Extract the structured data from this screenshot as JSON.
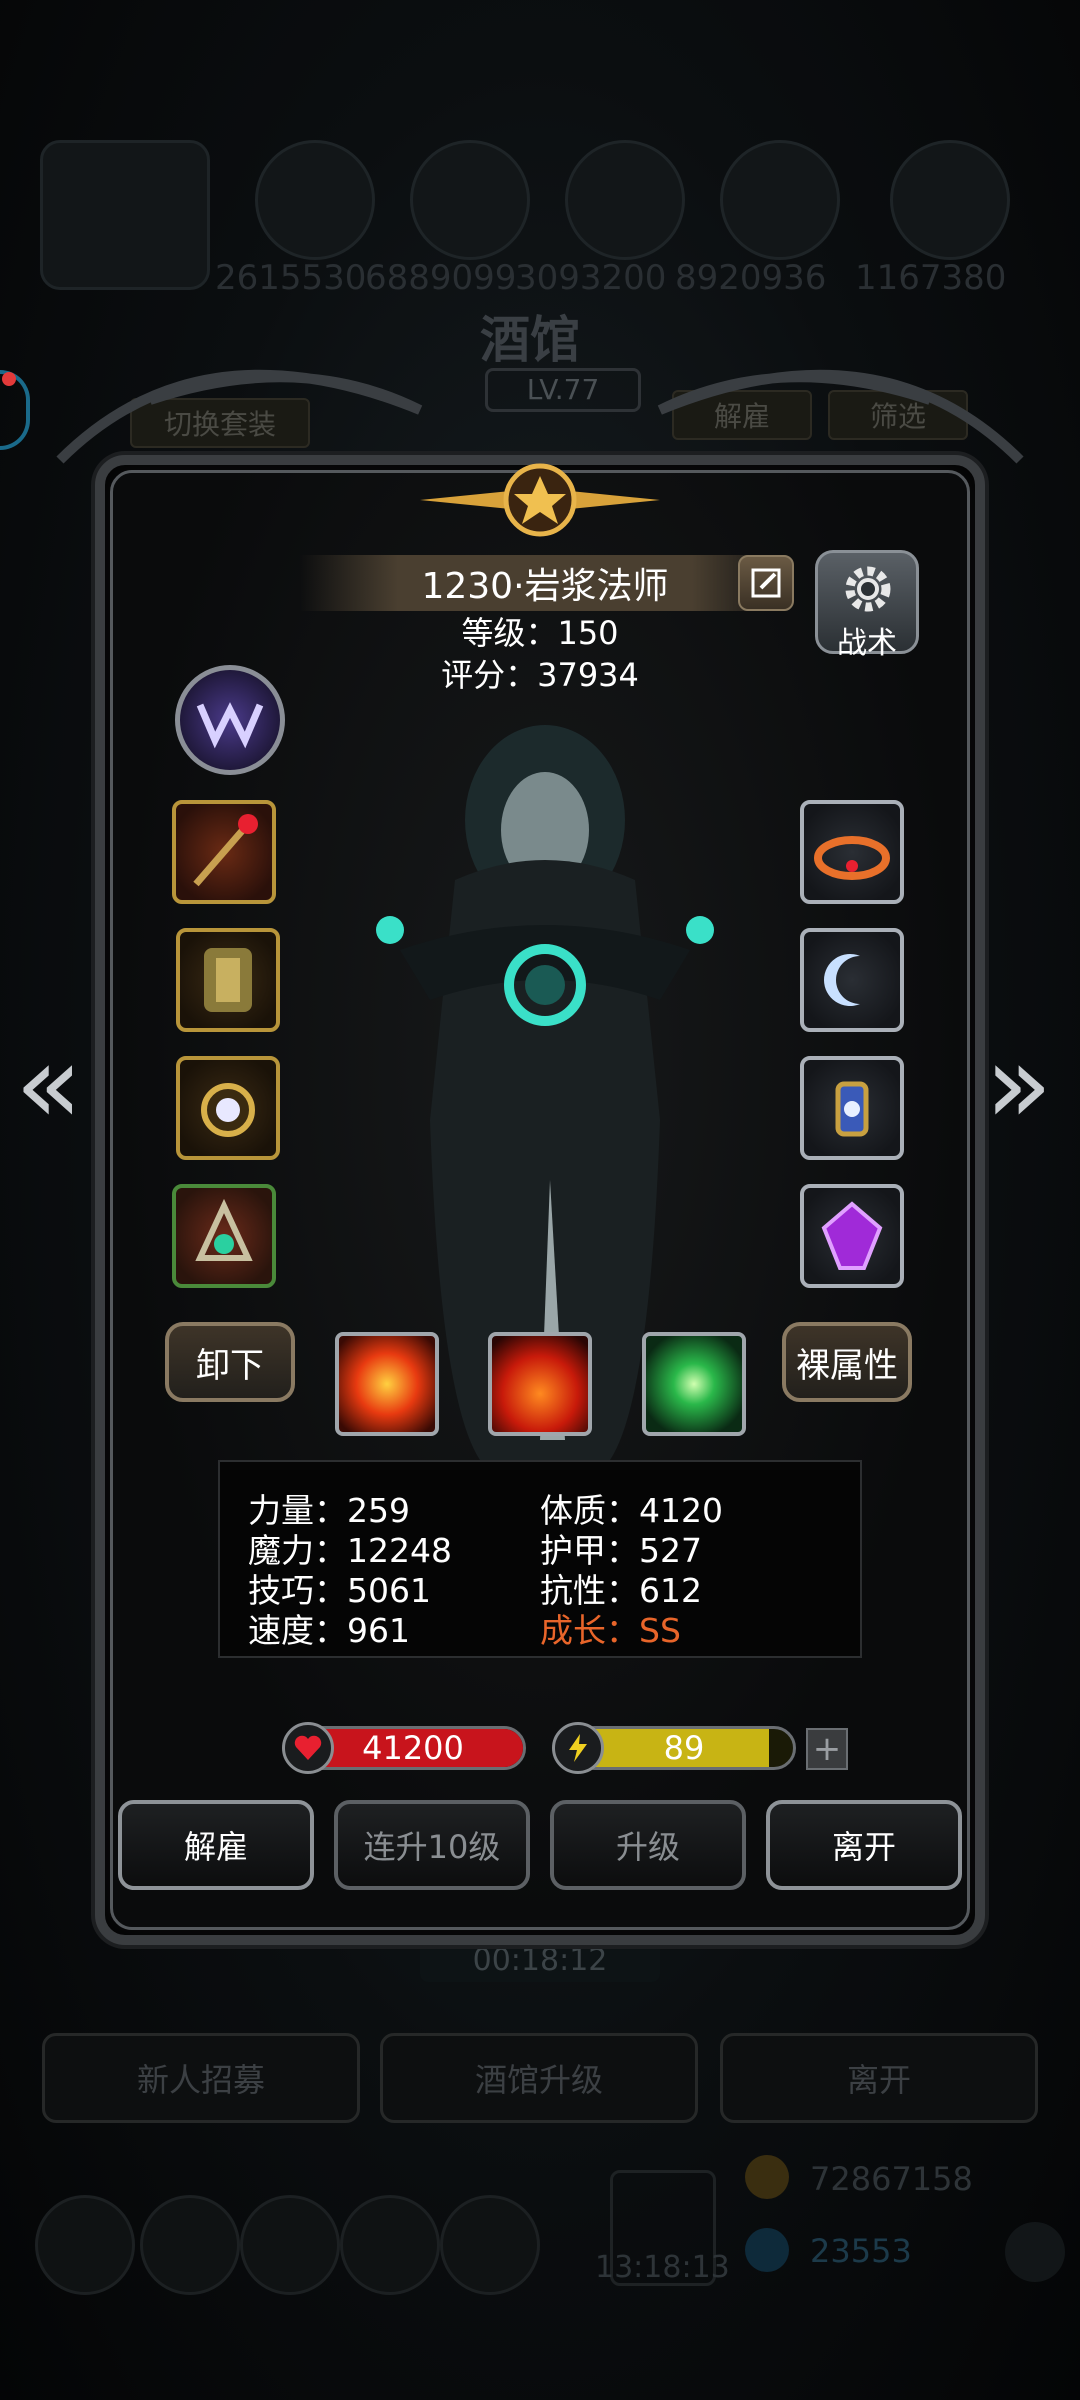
{
  "background": {
    "numbers": [
      "2615530",
      "6889099",
      "3093200",
      "8920936",
      "1167380"
    ],
    "title": "酒馆",
    "level": "LV.77",
    "switch_outfit": "切换套装",
    "dismiss": "解雇",
    "filter": "筛选",
    "timer": "00:18:12",
    "bottom_buttons": [
      "新人招募",
      "酒馆升级",
      "离开"
    ],
    "gold": "72867158",
    "gems": "23553",
    "clock": "13:18:13"
  },
  "hero": {
    "name": "1230·岩浆法师",
    "level_line": "等级：150",
    "score_line": "评分：37934",
    "tactics_label": "战术"
  },
  "equipment": {
    "left": [
      "staff-icon",
      "armor-icon",
      "amulet-icon",
      "relic-icon"
    ],
    "right": [
      "crown-icon",
      "moon-icon",
      "lantern-icon",
      "gem-icon"
    ],
    "rune": "demon-rune-icon"
  },
  "controls": {
    "unequip": "卸下",
    "bare_stats": "裸属性",
    "skills": [
      "explosion-skill-icon",
      "fire-skill-icon",
      "green-flame-skill-icon"
    ]
  },
  "stats": {
    "strength": "力量：259",
    "constitution": "体质：4120",
    "magic": "魔力：12248",
    "armor": "护甲：527",
    "skill": "技巧：5061",
    "resistance": "抗性：612",
    "speed": "速度：961",
    "growth": "成长：SS",
    "growth_color": "#e8652a"
  },
  "bars": {
    "hp": "41200",
    "hp_color": "#c8141c",
    "hp_fill": 1.0,
    "energy": "89",
    "energy_color": "#c8b414",
    "energy_fill": 0.89,
    "add": "+"
  },
  "actions": {
    "dismiss": "解雇",
    "level_up_10": "连升10级",
    "level_up": "升级",
    "leave": "离开"
  }
}
